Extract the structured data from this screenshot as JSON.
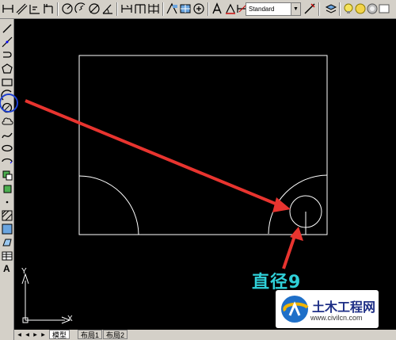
{
  "toolbar": {
    "text_style": "Standard"
  },
  "left_toolbar": {
    "text_tool_label": "A"
  },
  "canvas": {
    "ucs_y": "Y",
    "ucs_x": "X",
    "annotation": "直径9"
  },
  "tabs": {
    "nav": [
      "◀",
      "◀",
      "▶",
      "▶"
    ],
    "items": [
      "模型",
      "布局1",
      "布局2"
    ]
  },
  "watermark": {
    "title": "土木工程网",
    "url": "www.civilcn.com"
  },
  "colors": {
    "background": "#000000",
    "toolbar": "#d4d0c8",
    "geometry": "#ffffff",
    "arrow": "#e8342f",
    "highlight_circle": "#1d3fd0",
    "annotation": "#2fd0d8",
    "watermark_text": "#1e2f86"
  }
}
